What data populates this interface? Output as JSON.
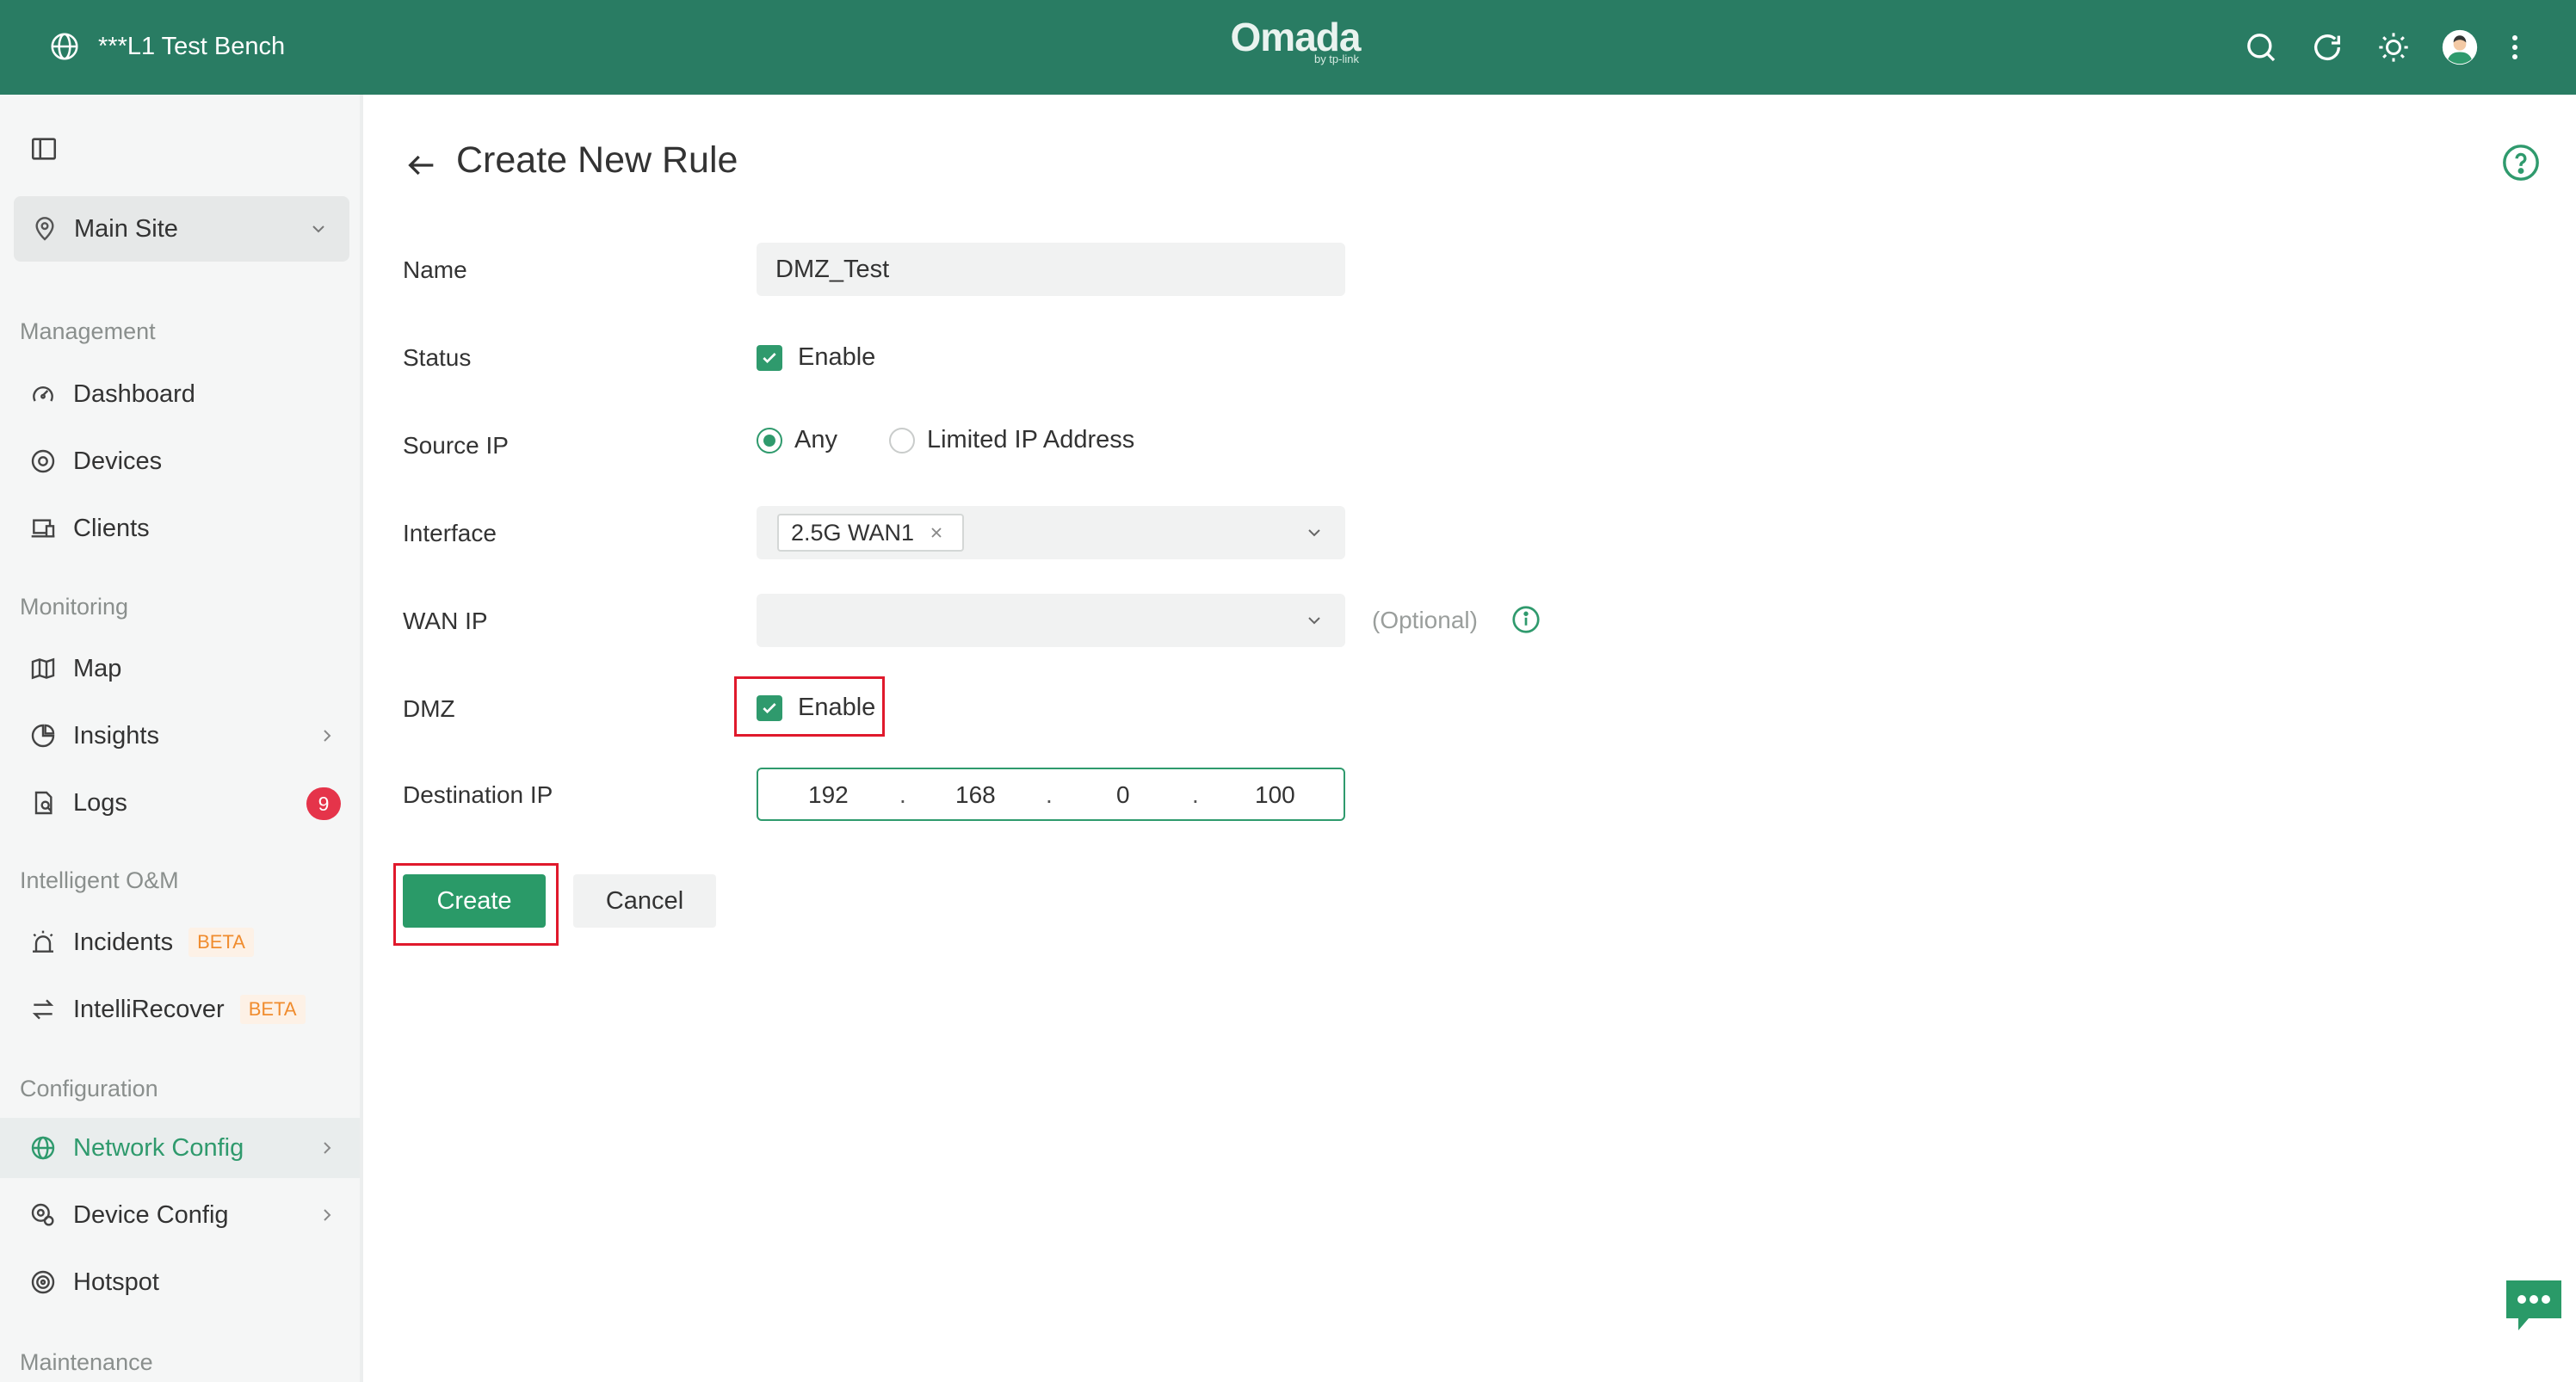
{
  "topbar": {
    "site_name": "***L1 Test Bench",
    "brand": "Omada",
    "brand_sub": "by tp-link",
    "icons": [
      "search-icon",
      "refresh-icon",
      "theme-sun-icon",
      "user-avatar",
      "more-vertical-icon"
    ]
  },
  "sidebar": {
    "site_selector": "Main Site",
    "sections": {
      "management": "Management",
      "monitoring": "Monitoring",
      "intelligent": "Intelligent O&M",
      "configuration": "Configuration",
      "maintenance": "Maintenance"
    },
    "items": {
      "dashboard": "Dashboard",
      "devices": "Devices",
      "clients": "Clients",
      "map": "Map",
      "insights": "Insights",
      "logs": "Logs",
      "logs_badge": "9",
      "incidents": "Incidents",
      "intellirecover": "IntelliRecover",
      "beta": "BETA",
      "network_config": "Network Config",
      "device_config": "Device Config",
      "hotspot": "Hotspot"
    },
    "active_item": "Network Config"
  },
  "main": {
    "title": "Create New Rule",
    "form": {
      "name_label": "Name",
      "name_value": "DMZ_Test",
      "status_label": "Status",
      "status_checkbox": "Enable",
      "status_checked": true,
      "source_ip_label": "Source IP",
      "source_any": "Any",
      "source_limited": "Limited IP Address",
      "source_selected": "Any",
      "interface_label": "Interface",
      "interface_tag": "2.5G WAN1",
      "wan_ip_label": "WAN IP",
      "wan_ip_value": "",
      "optional": "(Optional)",
      "dmz_label": "DMZ",
      "dmz_checkbox": "Enable",
      "dmz_checked": true,
      "dest_ip_label": "Destination IP",
      "dest_ip": [
        "192",
        "168",
        "0",
        "100"
      ],
      "dot": "."
    },
    "buttons": {
      "create": "Create",
      "cancel": "Cancel"
    }
  },
  "colors": {
    "topbar": "#297c63",
    "accent": "#2f9a6d",
    "create_button": "#2a9a68",
    "highlight": "#e0192c",
    "badge": "#e5344a",
    "beta_text": "#f08c2e"
  }
}
